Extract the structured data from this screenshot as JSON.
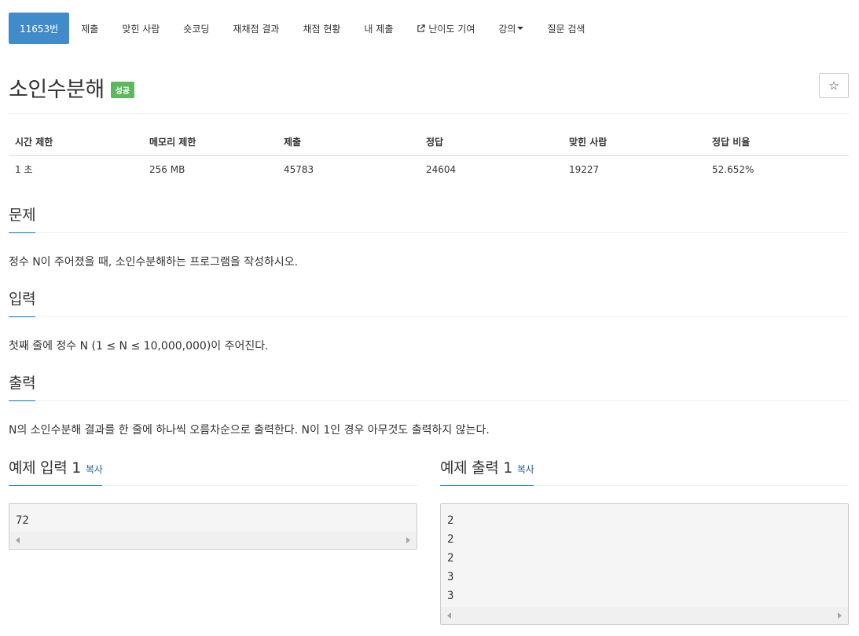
{
  "nav": {
    "items": [
      {
        "label": "11653번",
        "active": true
      },
      {
        "label": "제출"
      },
      {
        "label": "맞힌 사람"
      },
      {
        "label": "숏코딩"
      },
      {
        "label": "재채점 결과"
      },
      {
        "label": "채점 현황"
      },
      {
        "label": "내 제출"
      },
      {
        "label": "난이도 기여",
        "icon": "external-link-icon"
      },
      {
        "label": "강의",
        "icon": "caret-down-icon"
      },
      {
        "label": "질문 검색"
      }
    ]
  },
  "problem": {
    "title": "소인수분해",
    "status_badge": "성공",
    "star_icon": "☆"
  },
  "info_table": {
    "headers": [
      "시간 제한",
      "메모리 제한",
      "제출",
      "정답",
      "맞힌 사람",
      "정답 비율"
    ],
    "values": [
      "1 초",
      "256 MB",
      "45783",
      "24604",
      "19227",
      "52.652%"
    ]
  },
  "sections": {
    "problem": {
      "heading": "문제",
      "text": "정수 N이 주어졌을 때, 소인수분해하는 프로그램을 작성하시오."
    },
    "input": {
      "heading": "입력",
      "text": "첫째 줄에 정수 N (1 ≤ N ≤ 10,000,000)이 주어진다."
    },
    "output": {
      "heading": "출력",
      "text": "N의 소인수분해 결과를 한 줄에 하나씩 오름차순으로 출력한다. N이 1인 경우 아무것도 출력하지 않는다."
    }
  },
  "samples": {
    "input": {
      "heading": "예제 입력 1",
      "copy_label": "복사",
      "lines": [
        "72"
      ]
    },
    "output": {
      "heading": "예제 출력 1",
      "copy_label": "복사",
      "lines": [
        "2",
        "2",
        "2",
        "3",
        "3"
      ]
    }
  },
  "colors": {
    "active_nav": "#428bca",
    "success_badge": "#5cb85c",
    "heading_underline": "#0076c0",
    "link": "#2a6496"
  }
}
